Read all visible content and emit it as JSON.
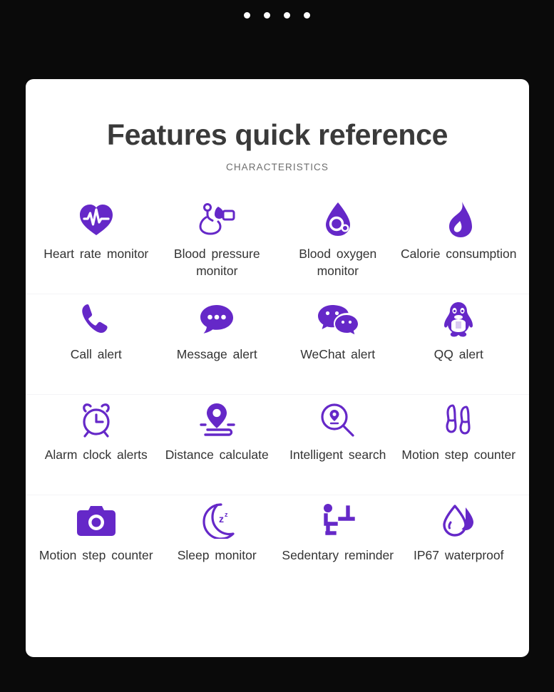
{
  "carousel": {
    "dot_count": 4,
    "dot_color": "#ffffff"
  },
  "card": {
    "title": "Features quick reference",
    "subtitle": "CHARACTERISTICS",
    "background": "#ffffff",
    "accent_color": "#6528c8",
    "title_color": "#3a3a3a",
    "subtitle_color": "#6e6e6e",
    "label_color": "#333333",
    "page_background": "#0a0a0a"
  },
  "features": [
    [
      {
        "icon": "heart-rate-icon",
        "label": "Heart rate monitor"
      },
      {
        "icon": "blood-pressure-icon",
        "label": "Blood pressure monitor"
      },
      {
        "icon": "blood-oxygen-icon",
        "label": "Blood oxygen monitor"
      },
      {
        "icon": "calorie-flame-icon",
        "label": "Calorie consumption"
      }
    ],
    [
      {
        "icon": "phone-call-icon",
        "label": "Call alert"
      },
      {
        "icon": "message-bubble-icon",
        "label": "Message alert"
      },
      {
        "icon": "wechat-icon",
        "label": "WeChat alert"
      },
      {
        "icon": "qq-penguin-icon",
        "label": "QQ alert"
      }
    ],
    [
      {
        "icon": "alarm-clock-icon",
        "label": "Alarm clock alerts"
      },
      {
        "icon": "location-pin-path-icon",
        "label": "Distance calculate"
      },
      {
        "icon": "search-pin-icon",
        "label": "Intelligent search"
      },
      {
        "icon": "footsteps-icon",
        "label": "Motion step counter"
      }
    ],
    [
      {
        "icon": "camera-icon",
        "label": "Motion step counter"
      },
      {
        "icon": "moon-sleep-icon",
        "label": "Sleep monitor"
      },
      {
        "icon": "sedentary-person-icon",
        "label": "Sedentary reminder"
      },
      {
        "icon": "water-drop-icon",
        "label": "IP67 waterproof"
      }
    ]
  ]
}
